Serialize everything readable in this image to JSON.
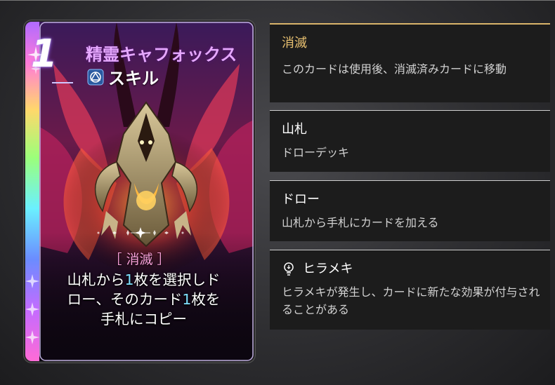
{
  "card": {
    "cost": "1",
    "name": "精霊キャフォックス",
    "type": "スキル",
    "keyword": "［ 消滅 ］",
    "desc_line1_a": "山札から",
    "desc_line1_num": "1",
    "desc_line1_b": "枚を選択しド",
    "desc_line2_a": "ロー、そのカード",
    "desc_line2_num": "1",
    "desc_line2_b": "枚を",
    "desc_line3": "手札にコピー",
    "type_icon": "skill-triangle-icon"
  },
  "tooltips": [
    {
      "title": "消滅",
      "desc": "このカードは使用後、消滅済みカードに移動"
    },
    {
      "title": "山札",
      "desc": "ドローデッキ"
    },
    {
      "title": "ドロー",
      "desc": "山札から手札にカードを加える"
    },
    {
      "title": "ヒラメキ",
      "desc": "ヒラメキが発生し、カードに新たな効果が付与されることがある",
      "icon": "lightbulb-icon"
    }
  ],
  "colors": {
    "accent_gold": "#e8c070",
    "card_name": "#e6a8ff",
    "keyword": "#f6a0d8",
    "number_highlight": "#7fe0ff",
    "tooltip_bg": "#1c1c1c"
  }
}
